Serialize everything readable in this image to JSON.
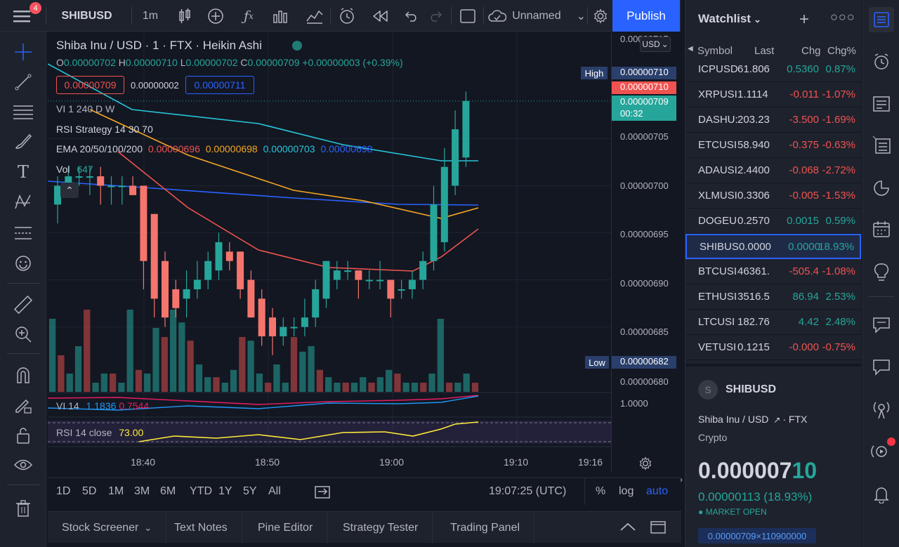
{
  "topbar": {
    "symbol": "SHIBUSD",
    "interval": "1m",
    "layout_name": "Unnamed",
    "publish": "Publish",
    "notif_count": "4"
  },
  "legend": {
    "title": "Shiba Inu / USD · 1 · FTX · Heikin Ashi",
    "currency": "USD",
    "ohlc": {
      "o": "0.00000702",
      "h": "0.00000710",
      "l": "0.00000702",
      "c": "0.00000709",
      "chg": "+0.00000003 (+0.39%)"
    },
    "sell": "0.00000709",
    "spread": "0.00000002",
    "buy": "0.00000711",
    "vi": "VI  1 240 D W",
    "rsi_strategy": "RSI Strategy 14 30 70",
    "ema_label": "EMA 20/50/100/200",
    "ema_values": [
      "0.00000696",
      "0.00000698",
      "0.00000703",
      "0.00000698"
    ],
    "vol_label": "Vol",
    "vol_value": "647",
    "vi_pane": {
      "label": "VI  14",
      "v1": "1.1836",
      "v2": "0.7544"
    },
    "rsi_pane": {
      "label": "RSI 14 close",
      "value": "73.00"
    }
  },
  "price_scale": {
    "top_partial": "0.00000715",
    "high_label": "High",
    "high_value": "0.00000710",
    "current": "0.00000710",
    "last": "0.00000709",
    "countdown": "00:32",
    "ticks": [
      "0.00000705",
      "0.00000700",
      "0.00000695",
      "0.00000690",
      "0.00000685"
    ],
    "low_label": "Low",
    "low_value": "0.00000682",
    "tick_680": "0.00000680",
    "vi_tick": "1.0000"
  },
  "time_axis": [
    "18:40",
    "18:50",
    "19:00",
    "19:10",
    "19:16"
  ],
  "range_bar": {
    "ranges": [
      "1D",
      "5D",
      "1M",
      "3M",
      "6M",
      "YTD",
      "1Y",
      "5Y",
      "All"
    ],
    "clock": "19:07:25 (UTC)",
    "pct": "%",
    "log": "log",
    "auto": "auto"
  },
  "bottom_tabs": [
    "Stock Screener",
    "Text Notes",
    "Pine Editor",
    "Strategy Tester",
    "Trading Panel"
  ],
  "watchlist": {
    "title": "Watchlist",
    "headers": [
      "Symbol",
      "Last",
      "Chg",
      "Chg%"
    ],
    "rows": [
      {
        "sym": "ICPUSD",
        "last": "61.806",
        "chg": "0.5360",
        "pct": "0.87%",
        "dir": "up"
      },
      {
        "sym": "XRPUSI",
        "last": "1.1114",
        "chg": "-0.011",
        "pct": "-1.07%",
        "dir": "dn"
      },
      {
        "sym": "DASHU:",
        "last": "203.23",
        "chg": "-3.500",
        "pct": "-1.69%",
        "dir": "dn"
      },
      {
        "sym": "ETCUSI",
        "last": "58.940",
        "chg": "-0.375",
        "pct": "-0.63%",
        "dir": "dn"
      },
      {
        "sym": "ADAUSI",
        "last": "2.4400",
        "chg": "-0.068",
        "pct": "-2.72%",
        "dir": "dn"
      },
      {
        "sym": "XLMUSI",
        "last": "0.3306",
        "chg": "-0.005",
        "pct": "-1.53%",
        "dir": "dn"
      },
      {
        "sym": "DOGEU",
        "last": "0.2570",
        "chg": "0.0015",
        "pct": "0.59%",
        "dir": "up"
      },
      {
        "sym": "SHIBUS",
        "last": "0.0000",
        "chg": "0.0000",
        "pct": "18.93%",
        "dir": "up"
      },
      {
        "sym": "BTCUSI",
        "last": "46361.",
        "chg": "-505.4",
        "pct": "-1.08%",
        "dir": "dn"
      },
      {
        "sym": "ETHUSI",
        "last": "3516.5",
        "chg": "86.94",
        "pct": "2.53%",
        "dir": "up"
      },
      {
        "sym": "LTCUSI",
        "last": "182.76",
        "chg": "4.42",
        "pct": "2.48%",
        "dir": "up"
      },
      {
        "sym": "VETUSI",
        "last": "0.1215",
        "chg": "-0.000",
        "pct": "-0.75%",
        "dir": "dn"
      }
    ]
  },
  "detail": {
    "logo": "S",
    "symbol": "SHIBUSD",
    "name": "Shiba Inu / USD",
    "exchange": "FTX",
    "type": "Crypto",
    "price_main": "0.000007",
    "price_tail": "10",
    "change": "0.00000113 (18.93%)",
    "status": "MARKET OPEN",
    "bottom": "0.00000709×110900000"
  },
  "colors": {
    "up": "#26a69a",
    "down": "#ef5350",
    "accent": "#2962ff"
  },
  "chart_data": {
    "type": "candlestick",
    "title": "Shiba Inu / USD · 1 · FTX · Heikin Ashi",
    "ylim": [
      6.79e-06,
      7.16e-06
    ],
    "x_ticks": [
      "18:40",
      "18:50",
      "19:00",
      "19:10",
      "19:16"
    ],
    "candles": [
      {
        "o": 6.98e-06,
        "h": 7.01e-06,
        "l": 6.96e-06,
        "c": 7e-06
      },
      {
        "o": 7e-06,
        "h": 7.02e-06,
        "l": 6.99e-06,
        "c": 7.01e-06
      },
      {
        "o": 7.01e-06,
        "h": 7.02e-06,
        "l": 7e-06,
        "c": 7.01e-06
      },
      {
        "o": 7.01e-06,
        "h": 7.02e-06,
        "l": 6.99e-06,
        "c": 7.01e-06
      },
      {
        "o": 7.01e-06,
        "h": 7.02e-06,
        "l": 6.98e-06,
        "c": 7e-06
      },
      {
        "o": 7e-06,
        "h": 7.01e-06,
        "l": 6.98e-06,
        "c": 7e-06
      },
      {
        "o": 7e-06,
        "h": 7.01e-06,
        "l": 6.98e-06,
        "c": 7e-06
      },
      {
        "o": 7e-06,
        "h": 7.01e-06,
        "l": 6.99e-06,
        "c": 6.99e-06
      },
      {
        "o": 7e-06,
        "h": 7e-06,
        "l": 6.89e-06,
        "c": 6.92e-06
      },
      {
        "o": 6.97e-06,
        "h": 6.97e-06,
        "l": 6.86e-06,
        "c": 6.88e-06
      },
      {
        "o": 6.92e-06,
        "h": 6.93e-06,
        "l": 6.85e-06,
        "c": 6.86e-06
      },
      {
        "o": 6.89e-06,
        "h": 6.9e-06,
        "l": 6.86e-06,
        "c": 6.87e-06
      },
      {
        "o": 6.88e-06,
        "h": 6.91e-06,
        "l": 6.86e-06,
        "c": 6.89e-06
      },
      {
        "o": 6.89e-06,
        "h": 6.92e-06,
        "l": 6.88e-06,
        "c": 6.9e-06
      },
      {
        "o": 6.9e-06,
        "h": 6.93e-06,
        "l": 6.89e-06,
        "c": 6.92e-06
      },
      {
        "o": 6.91e-06,
        "h": 6.95e-06,
        "l": 6.9e-06,
        "c": 6.94e-06
      },
      {
        "o": 6.93e-06,
        "h": 6.94e-06,
        "l": 6.91e-06,
        "c": 6.92e-06
      },
      {
        "o": 6.93e-06,
        "h": 6.93e-06,
        "l": 6.88e-06,
        "c": 6.89e-06
      },
      {
        "o": 6.9e-06,
        "h": 6.91e-06,
        "l": 6.86e-06,
        "c": 6.86e-06
      },
      {
        "o": 6.88e-06,
        "h": 6.89e-06,
        "l": 6.83e-06,
        "c": 6.84e-06
      },
      {
        "o": 6.86e-06,
        "h": 6.87e-06,
        "l": 6.82e-06,
        "c": 6.84e-06
      },
      {
        "o": 6.84e-06,
        "h": 6.86e-06,
        "l": 6.83e-06,
        "c": 6.85e-06
      },
      {
        "o": 6.85e-06,
        "h": 6.86e-06,
        "l": 6.84e-06,
        "c": 6.85e-06
      },
      {
        "o": 6.85e-06,
        "h": 6.88e-06,
        "l": 6.84e-06,
        "c": 6.86e-06
      },
      {
        "o": 6.86e-06,
        "h": 6.9e-06,
        "l": 6.85e-06,
        "c": 6.89e-06
      },
      {
        "o": 6.88e-06,
        "h": 6.92e-06,
        "l": 6.87e-06,
        "c": 6.92e-06
      },
      {
        "o": 6.9e-06,
        "h": 6.92e-06,
        "l": 6.89e-06,
        "c": 6.91e-06
      },
      {
        "o": 6.91e-06,
        "h": 6.92e-06,
        "l": 6.9e-06,
        "c": 6.91e-06
      },
      {
        "o": 6.91e-06,
        "h": 6.91e-06,
        "l": 6.88e-06,
        "c": 6.9e-06
      },
      {
        "o": 6.9e-06,
        "h": 6.91e-06,
        "l": 6.89e-06,
        "c": 6.9e-06
      },
      {
        "o": 6.9e-06,
        "h": 6.92e-06,
        "l": 6.89e-06,
        "c": 6.9e-06
      },
      {
        "o": 6.9e-06,
        "h": 6.9e-06,
        "l": 6.86e-06,
        "c": 6.88e-06
      },
      {
        "o": 6.89e-06,
        "h": 6.9e-06,
        "l": 6.88e-06,
        "c": 6.89e-06
      },
      {
        "o": 6.89e-06,
        "h": 6.91e-06,
        "l": 6.88e-06,
        "c": 6.9e-06
      },
      {
        "o": 6.9e-06,
        "h": 6.93e-06,
        "l": 6.89e-06,
        "c": 6.92e-06
      },
      {
        "o": 6.92e-06,
        "h": 7e-06,
        "l": 6.91e-06,
        "c": 6.98e-06
      },
      {
        "o": 6.94e-06,
        "h": 7.04e-06,
        "l": 6.93e-06,
        "c": 7.02e-06
      },
      {
        "o": 7e-06,
        "h": 7.08e-06,
        "l": 6.99e-06,
        "c": 7.06e-06
      },
      {
        "o": 7.03e-06,
        "h": 7.1e-06,
        "l": 7.02e-06,
        "c": 7.09e-06
      }
    ],
    "volume": [
      40,
      20,
      10,
      25,
      45,
      5,
      10,
      10,
      5,
      45,
      12,
      10,
      35,
      30,
      45,
      38,
      28,
      15,
      8,
      8,
      5,
      12,
      30,
      28,
      10,
      5,
      15,
      5,
      30,
      22,
      25,
      12,
      8,
      5,
      5,
      5,
      8,
      5,
      8,
      12,
      10,
      5,
      5,
      5,
      10,
      40,
      5,
      5,
      10,
      5
    ]
  }
}
